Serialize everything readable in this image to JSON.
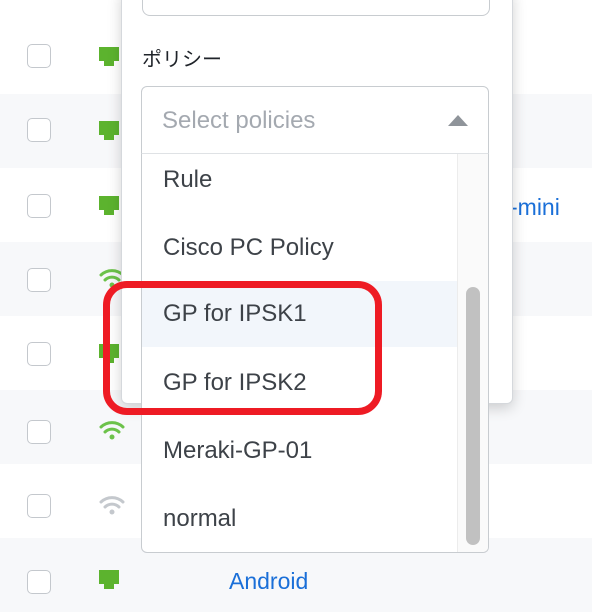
{
  "background": {
    "links": [
      "-mini",
      "Android"
    ]
  },
  "policy_field": {
    "label": "ポリシー",
    "placeholder": "Select policies"
  },
  "dropdown": {
    "options": [
      "Rule",
      "Cisco PC Policy",
      "GP for IPSK1",
      "GP for IPSK2",
      "Meraki-GP-01",
      "normal"
    ]
  },
  "colors": {
    "link": "#1a6fd8",
    "eth_icon": "#5cb32e",
    "wifi_icon_active": "#6cc24a",
    "wifi_icon_inactive": "#c4c8cd",
    "highlight": "#ee1b24"
  }
}
